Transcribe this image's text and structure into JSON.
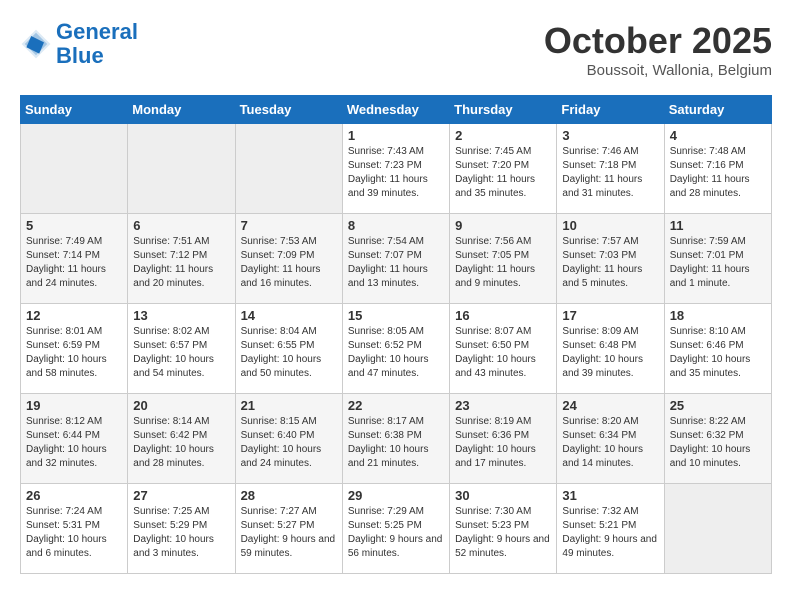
{
  "header": {
    "logo_line1": "General",
    "logo_line2": "Blue",
    "month": "October 2025",
    "location": "Boussoit, Wallonia, Belgium"
  },
  "weekdays": [
    "Sunday",
    "Monday",
    "Tuesday",
    "Wednesday",
    "Thursday",
    "Friday",
    "Saturday"
  ],
  "weeks": [
    [
      {
        "empty": true
      },
      {
        "empty": true
      },
      {
        "empty": true
      },
      {
        "day": 1,
        "sunrise": "7:43 AM",
        "sunset": "7:23 PM",
        "daylight": "11 hours and 39 minutes."
      },
      {
        "day": 2,
        "sunrise": "7:45 AM",
        "sunset": "7:20 PM",
        "daylight": "11 hours and 35 minutes."
      },
      {
        "day": 3,
        "sunrise": "7:46 AM",
        "sunset": "7:18 PM",
        "daylight": "11 hours and 31 minutes."
      },
      {
        "day": 4,
        "sunrise": "7:48 AM",
        "sunset": "7:16 PM",
        "daylight": "11 hours and 28 minutes."
      }
    ],
    [
      {
        "day": 5,
        "sunrise": "7:49 AM",
        "sunset": "7:14 PM",
        "daylight": "11 hours and 24 minutes."
      },
      {
        "day": 6,
        "sunrise": "7:51 AM",
        "sunset": "7:12 PM",
        "daylight": "11 hours and 20 minutes."
      },
      {
        "day": 7,
        "sunrise": "7:53 AM",
        "sunset": "7:09 PM",
        "daylight": "11 hours and 16 minutes."
      },
      {
        "day": 8,
        "sunrise": "7:54 AM",
        "sunset": "7:07 PM",
        "daylight": "11 hours and 13 minutes."
      },
      {
        "day": 9,
        "sunrise": "7:56 AM",
        "sunset": "7:05 PM",
        "daylight": "11 hours and 9 minutes."
      },
      {
        "day": 10,
        "sunrise": "7:57 AM",
        "sunset": "7:03 PM",
        "daylight": "11 hours and 5 minutes."
      },
      {
        "day": 11,
        "sunrise": "7:59 AM",
        "sunset": "7:01 PM",
        "daylight": "11 hours and 1 minute."
      }
    ],
    [
      {
        "day": 12,
        "sunrise": "8:01 AM",
        "sunset": "6:59 PM",
        "daylight": "10 hours and 58 minutes."
      },
      {
        "day": 13,
        "sunrise": "8:02 AM",
        "sunset": "6:57 PM",
        "daylight": "10 hours and 54 minutes."
      },
      {
        "day": 14,
        "sunrise": "8:04 AM",
        "sunset": "6:55 PM",
        "daylight": "10 hours and 50 minutes."
      },
      {
        "day": 15,
        "sunrise": "8:05 AM",
        "sunset": "6:52 PM",
        "daylight": "10 hours and 47 minutes."
      },
      {
        "day": 16,
        "sunrise": "8:07 AM",
        "sunset": "6:50 PM",
        "daylight": "10 hours and 43 minutes."
      },
      {
        "day": 17,
        "sunrise": "8:09 AM",
        "sunset": "6:48 PM",
        "daylight": "10 hours and 39 minutes."
      },
      {
        "day": 18,
        "sunrise": "8:10 AM",
        "sunset": "6:46 PM",
        "daylight": "10 hours and 35 minutes."
      }
    ],
    [
      {
        "day": 19,
        "sunrise": "8:12 AM",
        "sunset": "6:44 PM",
        "daylight": "10 hours and 32 minutes."
      },
      {
        "day": 20,
        "sunrise": "8:14 AM",
        "sunset": "6:42 PM",
        "daylight": "10 hours and 28 minutes."
      },
      {
        "day": 21,
        "sunrise": "8:15 AM",
        "sunset": "6:40 PM",
        "daylight": "10 hours and 24 minutes."
      },
      {
        "day": 22,
        "sunrise": "8:17 AM",
        "sunset": "6:38 PM",
        "daylight": "10 hours and 21 minutes."
      },
      {
        "day": 23,
        "sunrise": "8:19 AM",
        "sunset": "6:36 PM",
        "daylight": "10 hours and 17 minutes."
      },
      {
        "day": 24,
        "sunrise": "8:20 AM",
        "sunset": "6:34 PM",
        "daylight": "10 hours and 14 minutes."
      },
      {
        "day": 25,
        "sunrise": "8:22 AM",
        "sunset": "6:32 PM",
        "daylight": "10 hours and 10 minutes."
      }
    ],
    [
      {
        "day": 26,
        "sunrise": "7:24 AM",
        "sunset": "5:31 PM",
        "daylight": "10 hours and 6 minutes."
      },
      {
        "day": 27,
        "sunrise": "7:25 AM",
        "sunset": "5:29 PM",
        "daylight": "10 hours and 3 minutes."
      },
      {
        "day": 28,
        "sunrise": "7:27 AM",
        "sunset": "5:27 PM",
        "daylight": "9 hours and 59 minutes."
      },
      {
        "day": 29,
        "sunrise": "7:29 AM",
        "sunset": "5:25 PM",
        "daylight": "9 hours and 56 minutes."
      },
      {
        "day": 30,
        "sunrise": "7:30 AM",
        "sunset": "5:23 PM",
        "daylight": "9 hours and 52 minutes."
      },
      {
        "day": 31,
        "sunrise": "7:32 AM",
        "sunset": "5:21 PM",
        "daylight": "9 hours and 49 minutes."
      },
      {
        "empty": true
      }
    ]
  ]
}
